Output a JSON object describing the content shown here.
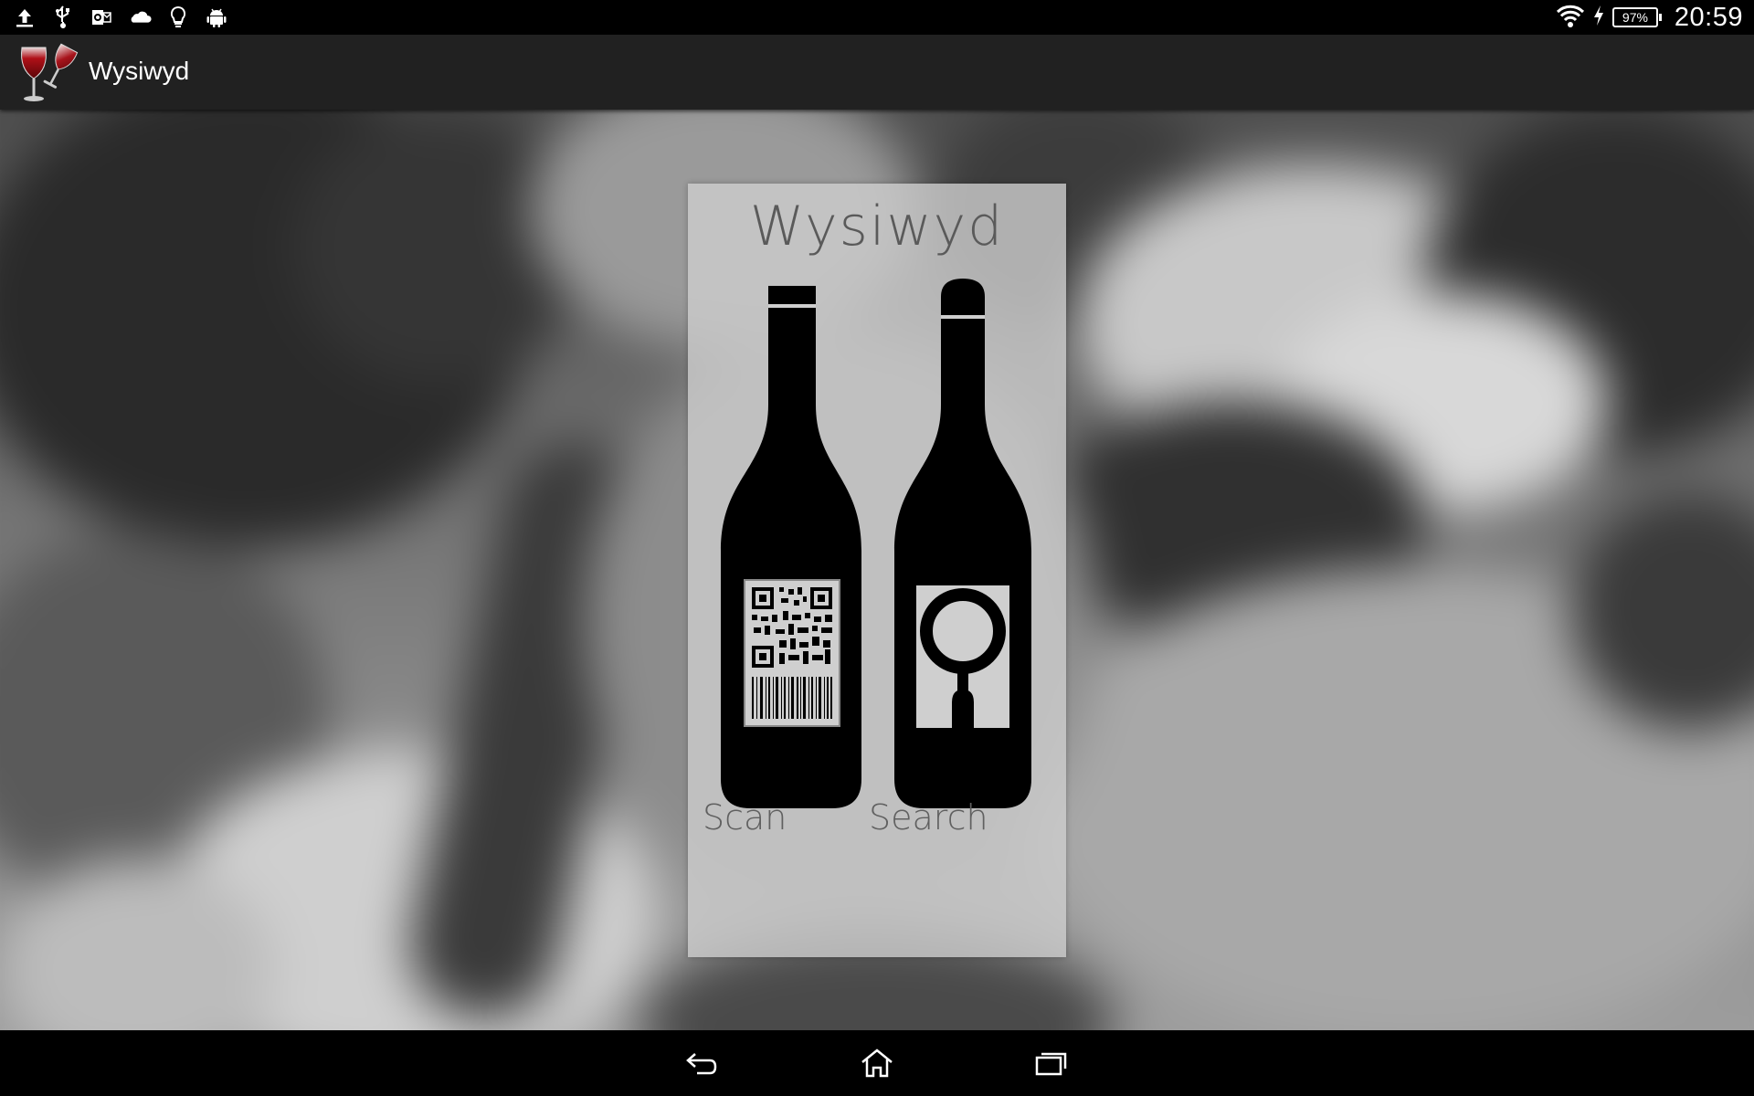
{
  "status_bar": {
    "time": "20:59",
    "battery_percent": "97%",
    "left_icons": [
      "upload-icon",
      "usb-icon",
      "outlook-icon",
      "cloud-icon",
      "lightbulb-icon",
      "android-icon"
    ],
    "right_icons": [
      "wifi-icon",
      "charging-icon",
      "battery-icon"
    ]
  },
  "action_bar": {
    "title": "Wysiwyd",
    "logo": "wine-glasses-icon"
  },
  "card": {
    "title": "Wysiwyd",
    "scan_label": "Scan",
    "search_label": "Search",
    "scan_icon": "qr-barcode-bottle-icon",
    "search_icon": "magnifier-bottle-icon"
  },
  "nav_bar": {
    "buttons": [
      "back-icon",
      "home-icon",
      "recent-apps-icon"
    ]
  },
  "colors": {
    "status_bar": "#000000",
    "action_bar": "#212121",
    "card": "#cdcdcd",
    "bottle": "#000000",
    "card_text": "#5a5a5a"
  }
}
